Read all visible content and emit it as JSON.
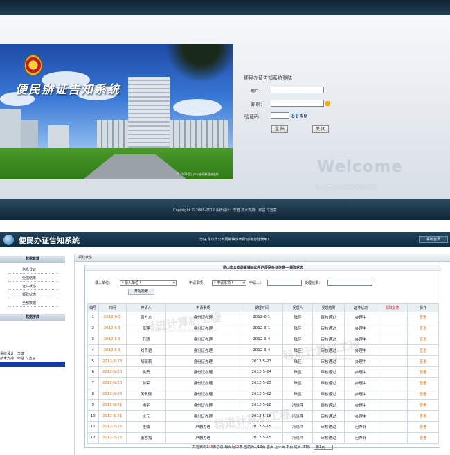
{
  "login": {
    "banner_title": "便民辦证告知系统",
    "banner_copyright": "© 2009  昆山市公安局新镇派出所",
    "form_title": "便民办证告知系统登陆",
    "user_label": "用户：",
    "password_label": "密  码：",
    "captcha_label": "验证码：",
    "captcha_value": "8040",
    "login_button": "登  陆",
    "close_button": "关  闭",
    "welcome": "Welcome",
    "station": "昆山市公安局新镇派出所",
    "footer": "Copyright © 2008-2012  系统设计：李健  技术支持：郎强  付宣意"
  },
  "header": {
    "system_name": "便民办证告知系统",
    "greeting": "您好,昆山市公安局新镇派出所,感谢您陆使用！",
    "home_button": "系统首页"
  },
  "sidebar": {
    "data_manage": "数据管理",
    "items": [
      "信息登记",
      "受理结果",
      "证件状态",
      "领取状态",
      "全部数据"
    ],
    "dictionary": "数据字典",
    "design": "系统设计：李健",
    "support": "技术支持：郎强  付宣意"
  },
  "content": {
    "breadcrumb": "领取状态",
    "panel_title": "昆山市公安局新镇派出所的便民办证信息---领取状态",
    "filter": {
      "unit_label": "录入单位：",
      "unit_select": "* 录入单位 *",
      "item_label": "申请事项：",
      "item_select": "* 申请事项 *",
      "applicant_label": "申请人：",
      "result_label": "受理结果：",
      "start_button": "开始检索"
    },
    "columns": [
      "编号",
      "时间",
      "申请人",
      "申请事项",
      "受理时间",
      "受理人",
      "受理结果",
      "证件状态",
      "领取状态",
      "操作"
    ],
    "rows": [
      {
        "no": "1",
        "date": "2012-6-5",
        "name": "周方方",
        "item": "身份证办理",
        "accept_date": "2012-6-1",
        "handler": "陆佳",
        "result": "审核通过",
        "status": "办理中",
        "pickup": "",
        "op": "查看"
      },
      {
        "no": "2",
        "date": "2012-6-5",
        "name": "张萍",
        "item": "身份证办理",
        "accept_date": "2012-6-1",
        "handler": "陆佳",
        "result": "审核通过",
        "status": "办理中",
        "pickup": "",
        "op": "查看"
      },
      {
        "no": "3",
        "date": "2012-6-5",
        "name": "苏慧",
        "item": "身份证办理",
        "accept_date": "2012-6-4",
        "handler": "陆佳",
        "result": "审核通过",
        "status": "办理中",
        "pickup": "",
        "op": "查看"
      },
      {
        "no": "4",
        "date": "2012-6-5",
        "name": "刘青君",
        "item": "身份证办理",
        "accept_date": "2012-6-4",
        "handler": "陆佳",
        "result": "审核通过",
        "status": "办理中",
        "pickup": "",
        "op": "查看"
      },
      {
        "no": "5",
        "date": "2012-5-28",
        "name": "胡丽莉",
        "item": "身份证办理",
        "accept_date": "2012-5-23",
        "handler": "陆佳",
        "result": "审核通过",
        "status": "办理中",
        "pickup": "",
        "op": "查看"
      },
      {
        "no": "6",
        "date": "2012-5-28",
        "name": "吴勇",
        "item": "身份证办理",
        "accept_date": "2012-5-24",
        "handler": "陆佳",
        "result": "审核通过",
        "status": "办理中",
        "pickup": "",
        "op": "查看"
      },
      {
        "no": "7",
        "date": "2012-5-28",
        "name": "游荣",
        "item": "身份证办理",
        "accept_date": "2012-5-25",
        "handler": "陆佳",
        "result": "审核通过",
        "status": "办理中",
        "pickup": "",
        "op": "查看"
      },
      {
        "no": "8",
        "date": "2012-5-23",
        "name": "黄佩佩",
        "item": "身份证办理",
        "accept_date": "2012-5-22",
        "handler": "陆佳",
        "result": "审核通过",
        "status": "办理中",
        "pickup": "",
        "op": "查看"
      },
      {
        "no": "9",
        "date": "2012-5-21",
        "name": "杨平",
        "item": "身份证办理",
        "accept_date": "2012-5-18",
        "handler": "冯晓萍",
        "result": "审核通过",
        "status": "办理中",
        "pickup": "",
        "op": "查看"
      },
      {
        "no": "10",
        "date": "2012-5-21",
        "name": "杭元",
        "item": "身份证办理",
        "accept_date": "2012-5-18",
        "handler": "冯晓萍",
        "result": "审核通过",
        "status": "办理中",
        "pickup": "",
        "op": "查看"
      },
      {
        "no": "11",
        "date": "2012-5-15",
        "name": "庄楠",
        "item": "户籍办理",
        "accept_date": "2012-5-15",
        "handler": "冯晓萍",
        "result": "审核通过",
        "status": "已办好",
        "pickup": "",
        "op": "查看"
      },
      {
        "no": "12",
        "date": "2012-5-15",
        "name": "唐志福",
        "item": "户籍办理",
        "accept_date": "2012-5-15",
        "handler": "冯晓萍",
        "result": "审核通过",
        "status": "已办好",
        "pickup": "",
        "op": "查看"
      }
    ],
    "pager": {
      "prefix": "共检索到",
      "total": "148",
      "mid1": "条信息  每页为",
      "per_page": "12",
      "mid2": "条  当前为",
      "current": "1",
      "mid3": "/13页  首页  上一页  下页  尾页  转到：",
      "goto": "第1页"
    },
    "watermark": "科进计算机工程",
    "watermark_en": "KEJIN COMPUTER ENGINEERING"
  }
}
